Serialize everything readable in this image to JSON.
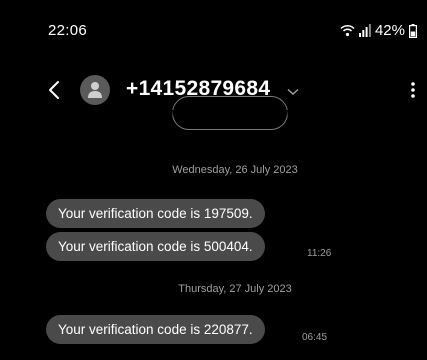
{
  "status_bar": {
    "time": "22:06",
    "battery_percent": "42%",
    "icons": [
      "wifi-icon",
      "signal-icon",
      "battery-icon"
    ]
  },
  "header": {
    "contact": "+14152879684",
    "icons": [
      "back-arrow-icon",
      "avatar-person-icon",
      "chevron-down-icon",
      "more-vertical-icon"
    ]
  },
  "conversation": {
    "groups": [
      {
        "date": "Wednesday, 26 July 2023",
        "messages": [
          {
            "text": "Your verification code is 197509.",
            "time": ""
          },
          {
            "text": "Your verification code is 500404.",
            "time": "11:26"
          }
        ]
      },
      {
        "date": "Thursday, 27 July 2023",
        "messages": [
          {
            "text": "Your verification code is 220877.",
            "time": "06:45"
          }
        ]
      }
    ]
  },
  "colors": {
    "background": "#000000",
    "bubble": "#4a4a4a",
    "secondary_text": "#9e9e9e",
    "avatar": "#5a5a5a"
  }
}
